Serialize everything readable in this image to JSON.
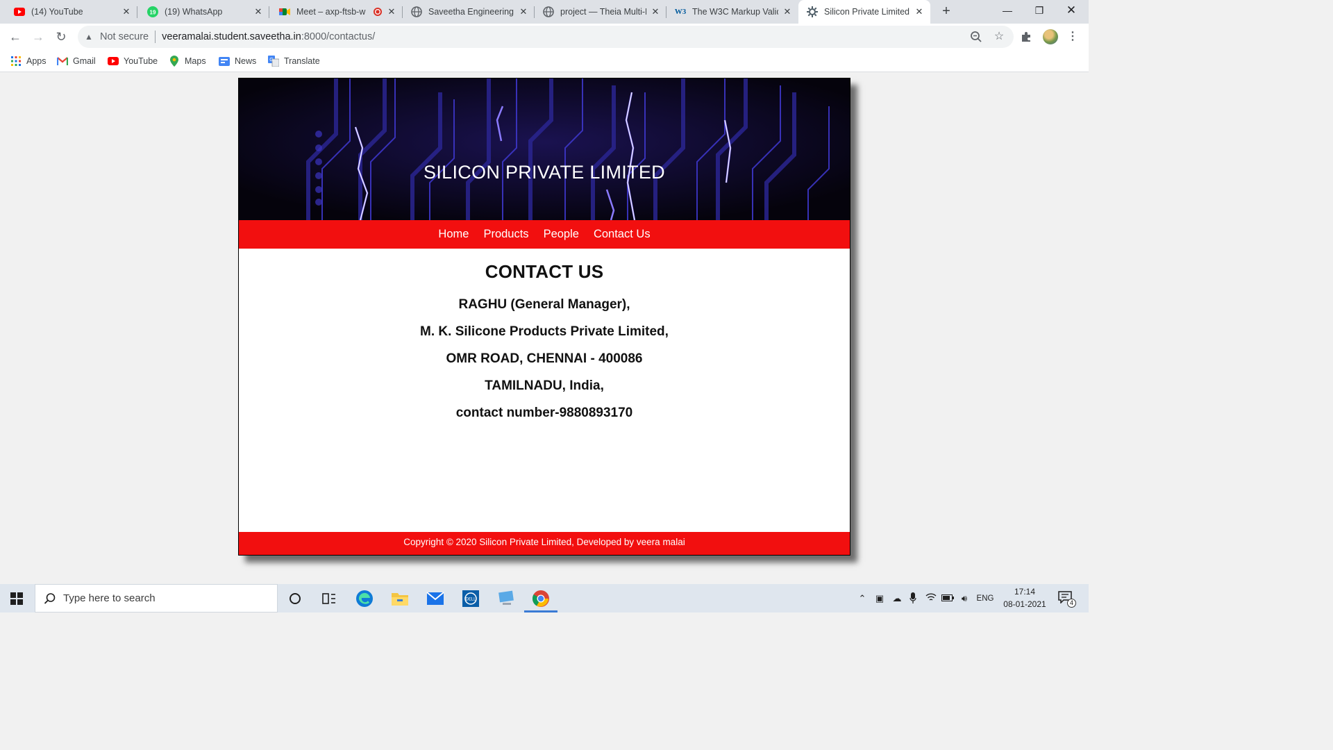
{
  "browser": {
    "tabs": [
      {
        "title": "(14) YouTube",
        "icon": "youtube-icon"
      },
      {
        "title": "(19) WhatsApp",
        "icon": "whatsapp-icon"
      },
      {
        "title": "Meet – axp-ftsb-w",
        "icon": "google-meet-icon"
      },
      {
        "title": "Saveetha Engineering C",
        "icon": "globe-icon"
      },
      {
        "title": "project — Theia Multi-L",
        "icon": "globe-icon"
      },
      {
        "title": "The W3C Markup Valid",
        "icon": "w3c-icon"
      },
      {
        "title": "Silicon Private Limited",
        "icon": "gear-favicon-icon"
      }
    ],
    "security_label": "Not secure",
    "url_host": "veeramalai.student.saveetha.in",
    "url_path": ":8000/contactus/",
    "bookmarks": [
      {
        "label": "Apps",
        "icon": "apps-grid-icon"
      },
      {
        "label": "Gmail",
        "icon": "gmail-icon"
      },
      {
        "label": "YouTube",
        "icon": "youtube-icon"
      },
      {
        "label": "Maps",
        "icon": "maps-pin-icon"
      },
      {
        "label": "News",
        "icon": "news-icon"
      },
      {
        "label": "Translate",
        "icon": "translate-icon"
      }
    ]
  },
  "site": {
    "banner_title": "SILICON PRIVATE LIMITED",
    "nav": [
      "Home",
      "Products",
      "People",
      "Contact Us"
    ],
    "heading": "CONTACT US",
    "address_lines": [
      "RAGHU (General Manager),",
      "M. K. Silicone Products Private Limited,",
      "OMR ROAD, CHENNAI - 400086",
      "TAMILNADU, India,",
      "contact number-9880893170"
    ],
    "footer": "Copyright © 2020 Silicon Private Limited, Developed by veera malai",
    "colors": {
      "nav_bg": "#f20f0f",
      "footer_bg": "#f20f0f",
      "banner_bg": "#07040f"
    }
  },
  "taskbar": {
    "search_placeholder": "Type here to search",
    "language": "ENG",
    "time": "17:14",
    "date": "08-01-2021",
    "notification_count": "4"
  }
}
